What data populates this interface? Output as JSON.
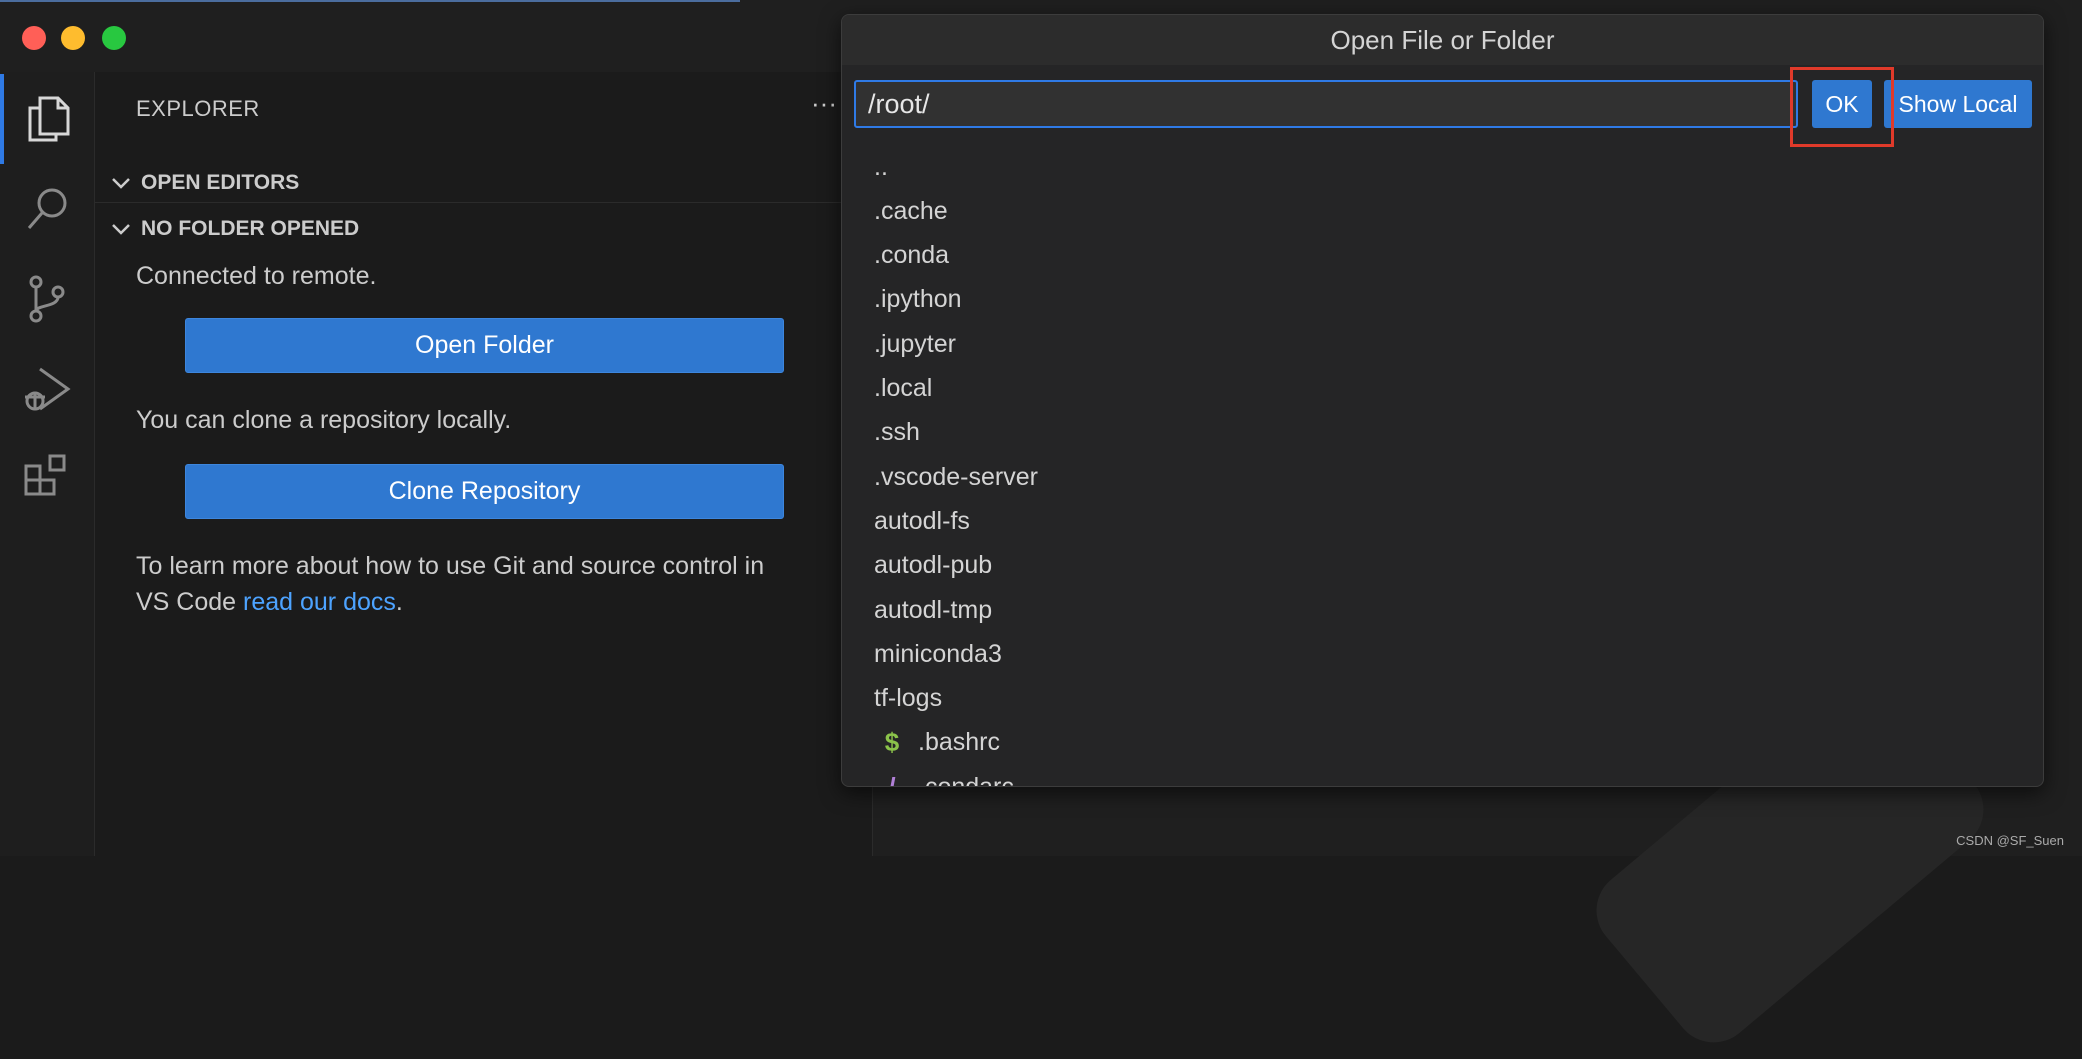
{
  "sidebar": {
    "title": "EXPLORER",
    "more_actions": "···",
    "sections": [
      {
        "label": "OPEN EDITORS"
      },
      {
        "label": "NO FOLDER OPENED"
      }
    ],
    "connected_text": "Connected to remote.",
    "open_folder_label": "Open Folder",
    "clone_text": "You can clone a repository locally.",
    "clone_label": "Clone Repository",
    "learn_text_1": "To learn more about how to use Git and source control in",
    "learn_text_2": "VS Code ",
    "learn_link": "read our docs",
    "learn_end": "."
  },
  "activity": {
    "icons": [
      "files-icon",
      "search-icon",
      "source-control-icon",
      "run-debug-icon",
      "extensions-icon"
    ]
  },
  "dialog": {
    "title": "Open File or Folder",
    "path_value": "/root/",
    "ok_label": "OK",
    "show_local_label": "Show Local",
    "items": [
      {
        "name": ".."
      },
      {
        "name": ".cache"
      },
      {
        "name": ".conda"
      },
      {
        "name": ".ipython"
      },
      {
        "name": ".jupyter"
      },
      {
        "name": ".local"
      },
      {
        "name": ".ssh"
      },
      {
        "name": ".vscode-server"
      },
      {
        "name": "autodl-fs"
      },
      {
        "name": "autodl-pub"
      },
      {
        "name": "autodl-tmp"
      },
      {
        "name": "miniconda3"
      },
      {
        "name": "tf-logs"
      },
      {
        "name": ".bashrc",
        "icon": "$",
        "icon_color": "#8bc34a"
      },
      {
        "name": ".condarc",
        "icon": "/",
        "icon_color": "#b180d7"
      }
    ]
  },
  "watermark": "CSDN @SF_Suen",
  "colors": {
    "accent": "#2f78d0",
    "highlight": "#e03a2a",
    "link": "#4da3ff"
  }
}
